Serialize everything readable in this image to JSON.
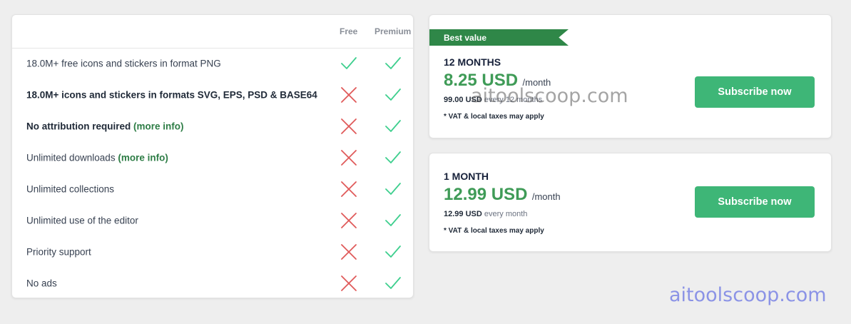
{
  "comparison": {
    "columns": {
      "free": "Free",
      "premium": "Premium"
    },
    "features": [
      {
        "label": "18.0M+ free icons and stickers in format PNG",
        "bold": false,
        "more_info": "",
        "free": "check",
        "premium": "check"
      },
      {
        "label": "18.0M+ icons and stickers in formats SVG, EPS, PSD & BASE64",
        "bold": true,
        "more_info": "",
        "free": "cross",
        "premium": "check"
      },
      {
        "label": "No attribution required",
        "bold": true,
        "more_info": "(more info)",
        "free": "cross",
        "premium": "check"
      },
      {
        "label": "Unlimited downloads",
        "bold": false,
        "more_info": "(more info)",
        "free": "cross",
        "premium": "check"
      },
      {
        "label": "Unlimited collections",
        "bold": false,
        "more_info": "",
        "free": "cross",
        "premium": "check"
      },
      {
        "label": "Unlimited use of the editor",
        "bold": false,
        "more_info": "",
        "free": "cross",
        "premium": "check"
      },
      {
        "label": "Priority support",
        "bold": false,
        "more_info": "",
        "free": "cross",
        "premium": "check"
      },
      {
        "label": "No ads",
        "bold": false,
        "more_info": "",
        "free": "cross",
        "premium": "check"
      }
    ]
  },
  "plans": {
    "annual": {
      "badge": "Best value",
      "title": "12 MONTHS",
      "price": "8.25 USD",
      "unit": "/month",
      "billed_amount": "99.00 USD",
      "billed_period": "every 12 months",
      "vat": "* VAT & local taxes may apply",
      "button": "Subscribe now"
    },
    "monthly": {
      "title": "1 MONTH",
      "price": "12.99 USD",
      "unit": "/month",
      "billed_amount": "12.99 USD",
      "billed_period": "every month",
      "vat": "* VAT & local taxes may apply",
      "button": "Subscribe now"
    }
  },
  "watermarks": {
    "center": "aitoolscoop.com",
    "corner": "aitoolscoop.com"
  },
  "colors": {
    "check": "#3ecf8e",
    "cross": "#e05a5a",
    "accent_green": "#3f9b57",
    "button_green": "#3eb677",
    "ribbon_green": "#2f8748"
  }
}
